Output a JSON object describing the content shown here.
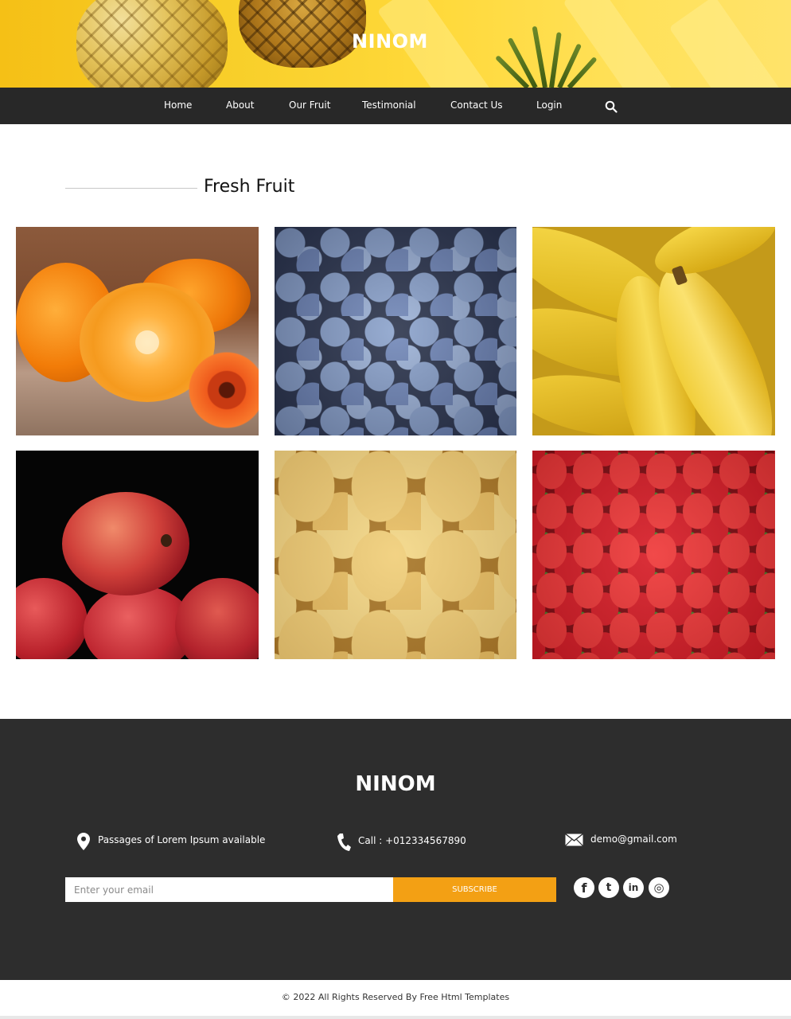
{
  "header": {
    "brand": "NINOM"
  },
  "nav": {
    "items": [
      {
        "label": "Home"
      },
      {
        "label": "About"
      },
      {
        "label": "Our Fruit"
      },
      {
        "label": "Testimonial"
      },
      {
        "label": "Contact Us"
      },
      {
        "label": "Login"
      }
    ],
    "search_icon": "search-icon"
  },
  "section": {
    "title": "Fresh Fruit"
  },
  "fruits": [
    {
      "name": "orange",
      "image": "orange-photo"
    },
    {
      "name": "blueberry",
      "image": "blueberry-photo"
    },
    {
      "name": "banana",
      "image": "banana-photo"
    },
    {
      "name": "apple",
      "image": "apple-photo"
    },
    {
      "name": "mango",
      "image": "mango-photo"
    },
    {
      "name": "strawberry",
      "image": "strawberry-photo"
    }
  ],
  "footer": {
    "brand": "NINOM",
    "address": "Passages of Lorem Ipsum available",
    "phone": "Call : +012334567890",
    "email": "demo@gmail.com",
    "newsletter": {
      "placeholder": "Enter your email",
      "button_label": "SUBSCRIBE"
    },
    "social": [
      {
        "icon": "facebook-icon",
        "glyph": "f"
      },
      {
        "icon": "twitter-icon",
        "glyph": "t"
      },
      {
        "icon": "linkedin-icon",
        "glyph": "in"
      },
      {
        "icon": "instagram-icon",
        "glyph": "◎"
      }
    ],
    "copyright": "© 2022 All Rights Reserved By Free Html Templates"
  },
  "colors": {
    "nav_bg": "#282828",
    "footer_bg": "#2d2d2d",
    "accent": "#f3a014"
  }
}
